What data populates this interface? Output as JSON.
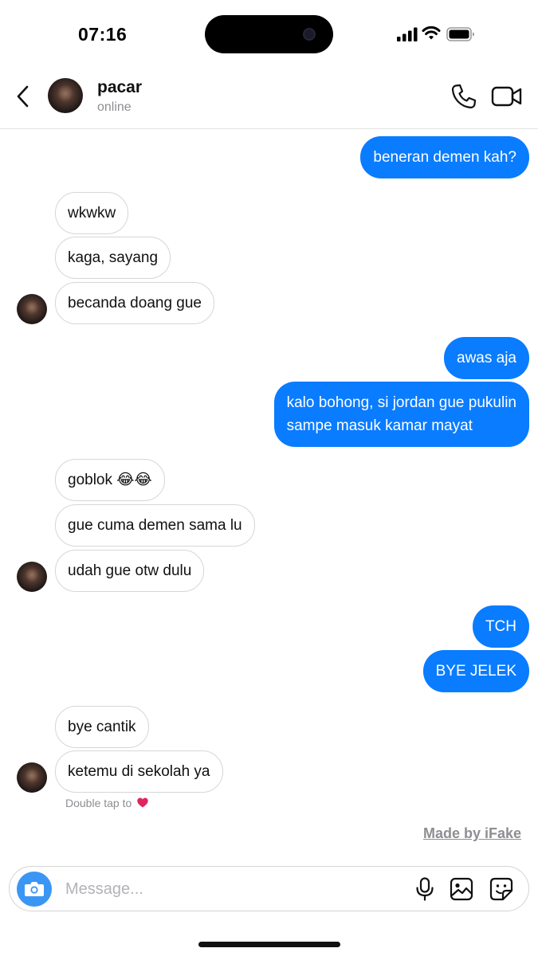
{
  "status_bar": {
    "time": "07:16"
  },
  "header": {
    "contact_name": "pacar",
    "contact_status": "online"
  },
  "messages": [
    {
      "direction": "outgoing",
      "text": "beneran demen kah?"
    },
    {
      "direction": "incoming",
      "text": "wkwkw"
    },
    {
      "direction": "incoming",
      "text": "kaga, sayang"
    },
    {
      "direction": "incoming",
      "text": "becanda doang gue"
    },
    {
      "direction": "outgoing",
      "text": "awas aja"
    },
    {
      "direction": "outgoing",
      "text": "kalo bohong, si jordan gue pukulin",
      "text_line2": "sampe masuk kamar mayat"
    },
    {
      "direction": "incoming",
      "text": "goblok 😂😂"
    },
    {
      "direction": "incoming",
      "text": "gue cuma demen sama lu"
    },
    {
      "direction": "incoming",
      "text": "udah gue otw dulu"
    },
    {
      "direction": "outgoing",
      "text": "TCH"
    },
    {
      "direction": "outgoing",
      "text": "BYE JELEK"
    },
    {
      "direction": "incoming",
      "text": "bye cantik"
    },
    {
      "direction": "incoming",
      "text": "ketemu di sekolah ya"
    }
  ],
  "reaction_hint": {
    "text": "Double tap to",
    "icon": "heart-icon",
    "color": "#e0245e"
  },
  "watermark": "Made by iFake",
  "composer": {
    "placeholder": "Message...",
    "value": ""
  },
  "colors": {
    "outgoing_bubble": "#0a7cff",
    "camera_button": "#3a96f4",
    "secondary_text": "#8e8e93"
  }
}
